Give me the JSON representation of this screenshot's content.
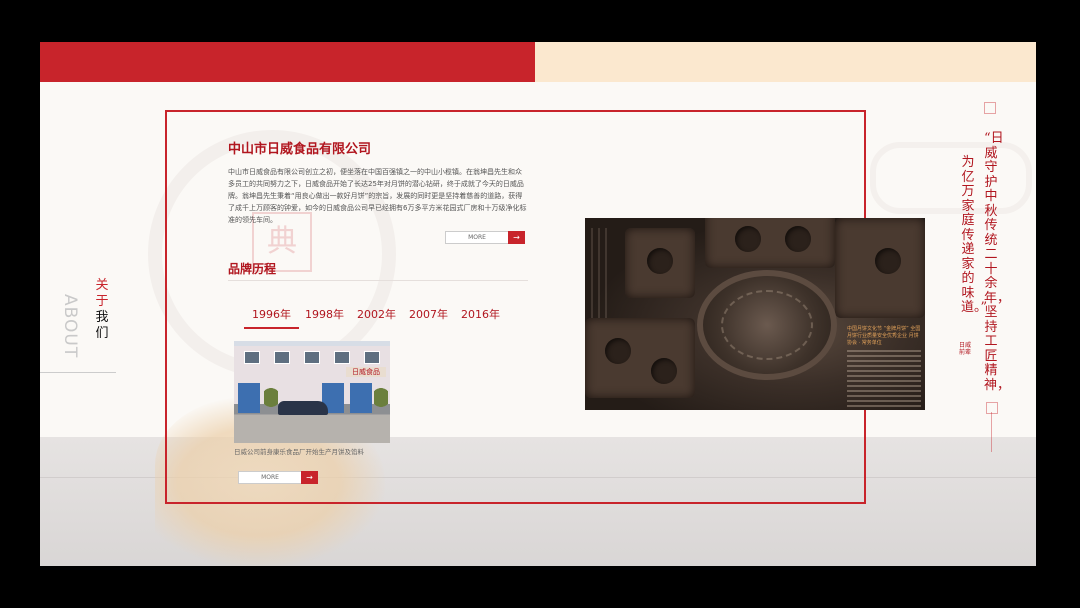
{
  "about": {
    "title_cn_red": "关于",
    "title_cn_black": "我们",
    "title_en": "ABOUT"
  },
  "company": {
    "name": "中山市日威食品有限公司",
    "description": "中山市日威食品有限公司创立之初，便坐落在中国百强镇之一的中山小榄镇。在翁坤昌先生和众多员工的共同努力之下，日威食品开始了长达25年对月饼的潜心钻研，终于成就了今天的日威品牌。翁坤昌先生秉着“用良心做出一款好月饼”的宗旨，发展的同时更是坚持着慈善的道路，获得了成千上万顾客的钟爱，如今的日威食品公司早已经拥有6万多平方米花园式厂房和十万级净化标准的领先车间。",
    "more_label": "MORE",
    "more_arrow": "→"
  },
  "history": {
    "title": "品牌历程",
    "years": [
      "1996年",
      "1998年",
      "2002年",
      "2007年",
      "2016年"
    ],
    "active_year_index": 0,
    "photo_sign": "日威食品",
    "photo_caption": "日威公司前身康乐食品厂开始生产月饼及馅料",
    "more_label": "MORE",
    "more_arrow": "→"
  },
  "hero": {
    "poster_text": "中国月饼文化节 “金牌月饼” 全国月饼行业质量安全优秀企业 月饼协会 · 常务单位",
    "stamp": "典"
  },
  "poem": {
    "line1": "“日威守护中秋传统二十余年，坚持工匠精神，",
    "line2": "为亿万家庭传递家的味道。”",
    "seal": "日威前辈"
  },
  "colors": {
    "brand_red": "#c8242b",
    "cream": "#fbe8cf",
    "dark_frame": "#000000"
  }
}
